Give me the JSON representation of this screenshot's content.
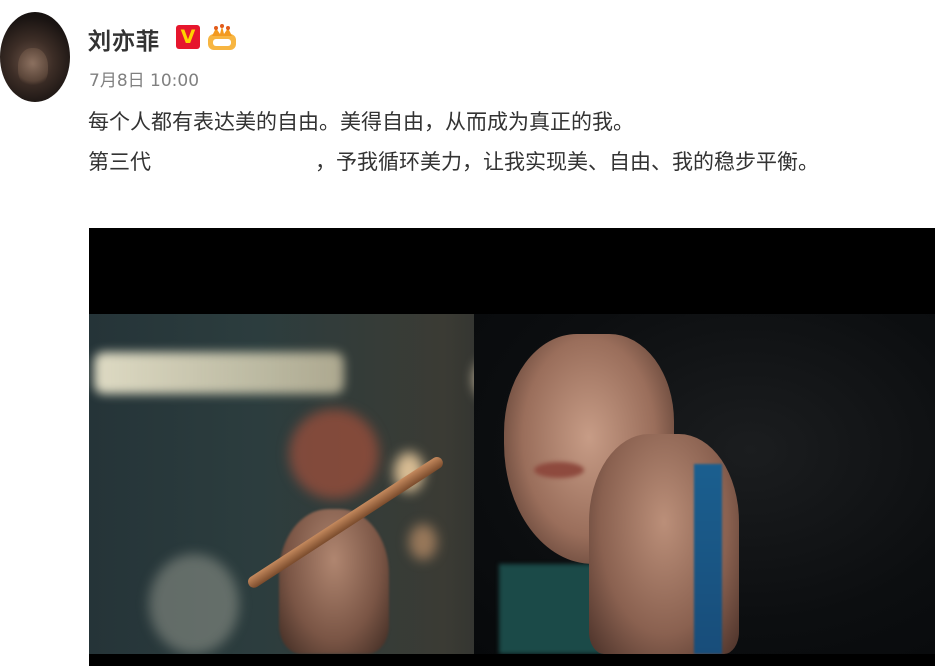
{
  "post": {
    "username": "刘亦菲",
    "verified_badge": "V",
    "timestamp": "7月8日 10:00",
    "text_line_1": "每个人都有表达美的自由。美得自由，从而成为真正的我。",
    "text_line_2_prefix": "第三代",
    "text_line_2_suffix": "，予我循环美力，让我实现美、自由、我的稳步平衡。"
  },
  "colors": {
    "username": "#333333",
    "timestamp": "#808080",
    "body_text": "#333333",
    "verified_bg": "#e6162d",
    "verified_fg": "#ffd200",
    "crown": "#f5a623",
    "video_bg": "#000000"
  },
  "icons": {
    "verified": "verified-v-icon",
    "crown": "crown-member-icon"
  }
}
